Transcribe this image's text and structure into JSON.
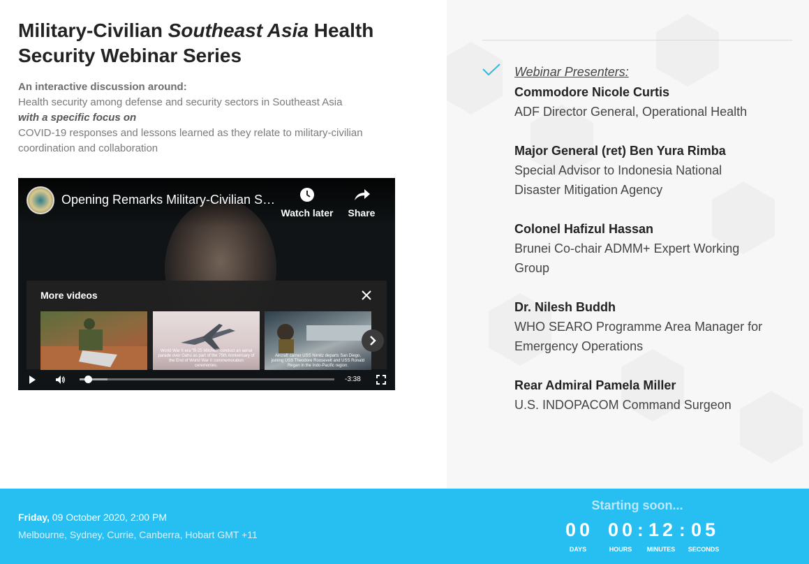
{
  "header": {
    "title_part1": "Military-Civilian ",
    "title_italic": "Southeast Asia",
    "title_part2": " Health Security Webinar Series"
  },
  "description": {
    "intro": "An interactive discussion around:",
    "line1": "Health security among defense and security sectors in Southeast Asia",
    "focus": "with a specific focus on",
    "line2": "COVID-19 responses and lessons learned as they relate to military-civilian coordination and collaboration"
  },
  "video": {
    "title": "Opening Remarks Military-Civilian So...",
    "watch_later": "Watch later",
    "share": "Share",
    "more_videos": "More videos",
    "thumbnails": [
      {
        "caption": ""
      },
      {
        "caption": "World War II era \"B-25 Mitchell\" conduct an aerial parade over Oahu as part of the 75th Anniversary of the End of World War II commemoration ceremonies."
      },
      {
        "caption": "Aircraft carrier USS Nimitz departs San Diego, joining USS Theodore Roosevelt and USS Ronald Regan in the Indo-Pacific region."
      }
    ],
    "time_remaining": "-3:38",
    "progress_fraction": 0.02
  },
  "presenters": {
    "label": "Webinar Presenters:",
    "list": [
      {
        "name": "Commodore Nicole Curtis",
        "role": "ADF Director General, Operational Health"
      },
      {
        "name": "Major General (ret) Ben Yura Rimba",
        "role": "Special Advisor to Indonesia National Disaster Mitigation Agency"
      },
      {
        "name": "Colonel Hafizul Hassan",
        "role": "Brunei Co-chair ADMM+ Expert Working Group"
      },
      {
        "name": "Dr. Nilesh Buddh",
        "role": "WHO SEARO Programme Area Manager for Emergency Operations"
      },
      {
        "name": "Rear Admiral Pamela Miller",
        "role": "U.S. INDOPACOM Command Surgeon"
      }
    ]
  },
  "footer": {
    "day": "Friday,",
    "date": " 09 October 2020, 2:00 PM",
    "location": "Melbourne, Sydney, Currie, Canberra, Hobart GMT +11",
    "status": "Starting soon...",
    "countdown": {
      "days": "00",
      "hours": "00",
      "minutes": "12",
      "seconds": "05",
      "days_label": "DAYS",
      "hours_label": "HOURS",
      "minutes_label": "MINUTES",
      "seconds_label": "SECONDS"
    }
  },
  "colors": {
    "accent": "#27bef2",
    "check": "#35b8d8"
  }
}
